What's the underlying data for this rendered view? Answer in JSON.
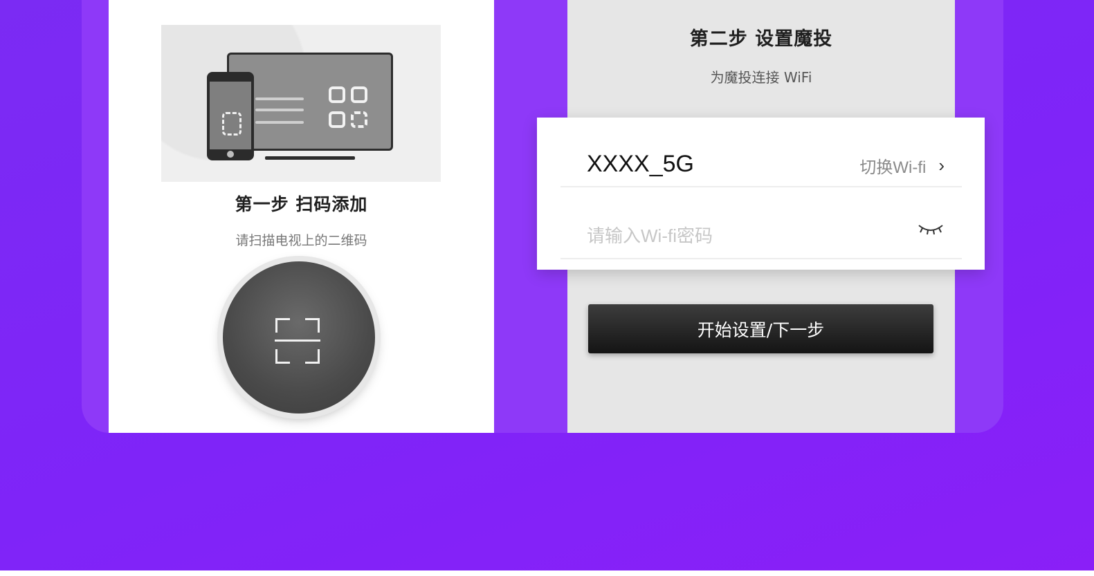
{
  "step1": {
    "title": "第一步  扫码添加",
    "subtitle": "请扫描电视上的二维码",
    "illustration_icon": "tv-phone-qr-illustration",
    "scan_icon": "scan-icon"
  },
  "step2": {
    "title": "第二步  设置魔投",
    "subtitle": "为魔投连接 WiFi"
  },
  "wifi": {
    "ssid": "XXXX_5G",
    "switch_label": "切换Wi-fi",
    "switch_icon": "chevron-right-icon",
    "password_value": "",
    "password_placeholder": "请输入Wi-fi密码",
    "visibility_icon": "eye-closed-icon"
  },
  "actions": {
    "start_label": "开始设置/下一步"
  },
  "colors": {
    "background": "#7f24f8",
    "frame": "#8e39f8",
    "button": "#1a1a1a"
  }
}
